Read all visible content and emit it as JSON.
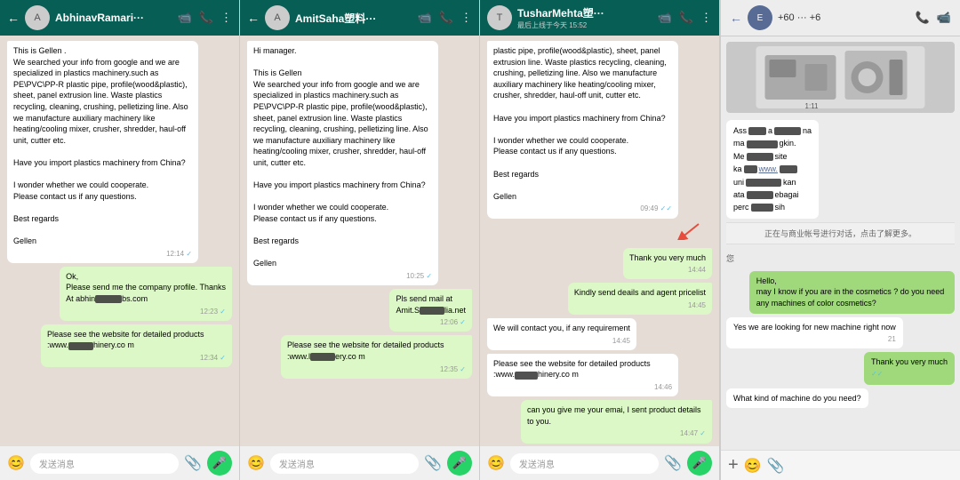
{
  "panels": [
    {
      "id": "abhinav",
      "contact": "AbhinavRamari···",
      "messages": [
        {
          "type": "received",
          "text": "This is Gellen .\nWe searched your info from google and we are specialized in plastics machinery.such as PE\\PVC\\PP-R plastic pipe, profile(wood&plastic), sheet, panel extrusion line. Waste plastics recycling, cleaning, crushing, pelletizing line. Also we manufacture auxiliary machinery like heating/cooling mixer, crusher, shredder, haul-off unit, cutter etc.\n\nHave you import plastics machinery from China?\n\nI wonder whether we could cooperate.\nPlease contact us if any questions.\n\nBest regards\n\nGellen",
          "time": "12:14",
          "ticks": "✓"
        },
        {
          "type": "sent",
          "text": "Ok,\nPlease send me the company profile. Thanks\nAt abhin     bs.com",
          "time": "12:23",
          "ticks": "✓"
        },
        {
          "type": "sent",
          "text": "Please see the website for detailed products :www.     hinery.co m",
          "time": "12:34",
          "ticks": "✓"
        }
      ],
      "footer_placeholder": "发送消息"
    },
    {
      "id": "amitsaha",
      "contact": "AmitSaha塑料···",
      "messages": [
        {
          "type": "received",
          "text": "Hi manager.\n\nThis is Gellen\nWe searched your info from google and we are specialized in plastics machinery.such as PE\\PVC\\PP-R plastic pipe, profile(wood&plastic), sheet, panel extrusion line. Waste plastics recycling, cleaning, crushing, pelletizing line. Also we manufacture auxiliary machinery like heating/cooling mixer, crusher, shredder, haul-off unit, cutter etc.\n\nHave you import plastics machinery from China?\n\nI wonder whether we could cooperate.\nPlease contact us if any questions.\n\nBest regards\n\nGellen",
          "time": "10:25",
          "ticks": "✓"
        },
        {
          "type": "sent",
          "text": "Pls send mail at\nAmit.S     lia.net",
          "time": "12:06",
          "ticks": "✓"
        },
        {
          "type": "sent",
          "text": "Please see the website for detailed products :www.l     ery.co m",
          "time": "12:35",
          "ticks": "✓"
        }
      ],
      "footer_placeholder": "发送消息"
    },
    {
      "id": "tusharmehta",
      "contact": "TusharMehta塑···",
      "subtitle": "最后上线于今天 15:52",
      "messages": [
        {
          "type": "received",
          "text": "plastic pipe, profile(wood&plastic), sheet, panel extrusion line. Waste plastics recycling, cleaning, crushing, pelletizing line. Also we manufacture auxiliary machinery like heating/cooling mixer, crusher, shredder, haul-off unit, cutter etc.\n\nHave you import plastics machinery from China?\n\nI wonder whether we could cooperate.\nPlease contact us if any questions.\n\nBest regards\n\nGellen",
          "time": "09:49",
          "ticks": "✓✓"
        },
        {
          "type": "sent",
          "text": "Thank you very much",
          "time": "14:44",
          "ticks": ""
        },
        {
          "type": "sent",
          "text": "Kindly send deails and agent pricelist",
          "time": "14:45",
          "ticks": ""
        },
        {
          "type": "received",
          "text": "We will contact you, if any requirement",
          "time": "14:45",
          "ticks": ""
        },
        {
          "type": "received",
          "text": "Please see the website for detailed products :www.     hinery.co m",
          "time": "14:46",
          "ticks": ""
        },
        {
          "type": "sent",
          "text": "can you give me your emai, I sent product details to you.",
          "time": "14:47",
          "ticks": "✓"
        }
      ],
      "footer_placeholder": "发送消息"
    }
  ],
  "wechat": {
    "contact": "+60  ···  +6",
    "info_bar": "正在与商业帐号进行对话，点击了解更多。",
    "messages": [
      {
        "type": "received_blurred",
        "text": "Ass  a      na\nma       gkin.\nMe       site\nka  www.    \nuni         kan\nata          ebagai\nperc        sih"
      },
      {
        "type": "sent",
        "text": "您\nHello,\nmay I know if you are in the cosmetics ? do you need any machines of color cosmetics?"
      },
      {
        "type": "received",
        "text": "Yes we are looking for new machine right now"
      },
      {
        "type": "sent",
        "text": "Thank you very much"
      },
      {
        "type": "received",
        "text": "What kind of machine do you need?"
      }
    ],
    "footer_plus": "+",
    "footer_icons": [
      "😊",
      "📎"
    ]
  },
  "icons": {
    "back": "←",
    "video": "📹",
    "phone": "📞",
    "more": "⋮",
    "emoji": "😊",
    "attach": "📎",
    "mic": "🎤",
    "search": "🔍"
  }
}
